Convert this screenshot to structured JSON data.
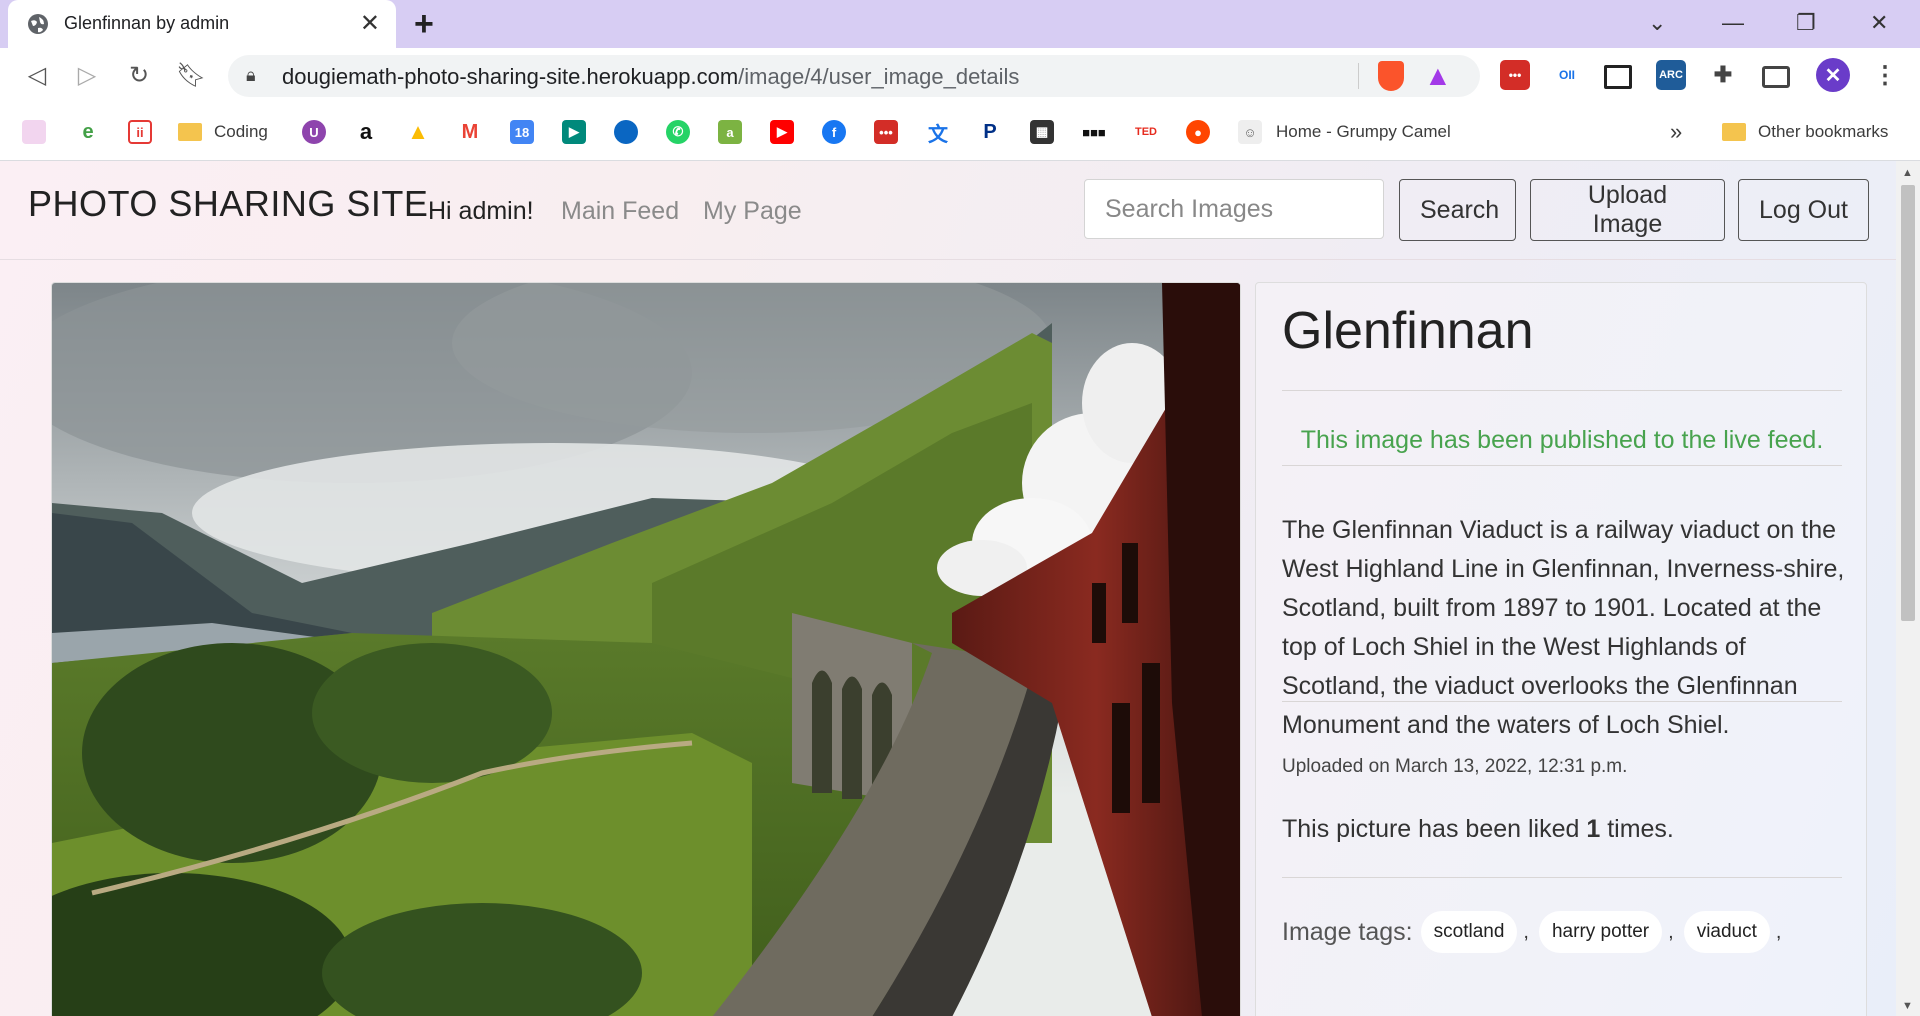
{
  "browser": {
    "tab_title": "Glenfinnan by admin",
    "new_tab": "+",
    "url_host": "dougiemath-photo-sharing-site.herokuapp.com",
    "url_path": "/image/4/user_image_details",
    "bookmarks": [
      {
        "label": "Coding"
      },
      {
        "label": "Home - Grumpy Camel"
      },
      {
        "label": "Other bookmarks"
      }
    ],
    "more_bookmarks": "»"
  },
  "site": {
    "brand": "PHOTO SHARING SITE",
    "greeting": "Hi admin!",
    "nav": [
      "Main Feed",
      "My Page"
    ],
    "search_placeholder": "Search Images",
    "search_button": "Search",
    "upload_button": "Upload Image",
    "logout_button": "Log Out"
  },
  "image": {
    "title": "Glenfinnan",
    "published_notice": "This image has been published to the live feed.",
    "description": "The Glenfinnan Viaduct is a railway viaduct on the West Highland Line in Glenfinnan, Inverness-shire, Scotland, built from 1897 to 1901. Located at the top of Loch Shiel in the West Highlands of Scotland, the viaduct overlooks the Glenfinnan Monument and the waters of Loch Shiel.",
    "uploaded": "Uploaded on March 13, 2022, 12:31 p.m.",
    "likes_prefix": "This picture has been liked",
    "likes_count": "1",
    "likes_suffix": "times.",
    "tags_label": "Image tags:",
    "tags": [
      "scotland",
      "harry potter",
      "viaduct"
    ]
  },
  "colors": {
    "published": "#48a34e",
    "tab_strip": "#d7cdf3"
  }
}
